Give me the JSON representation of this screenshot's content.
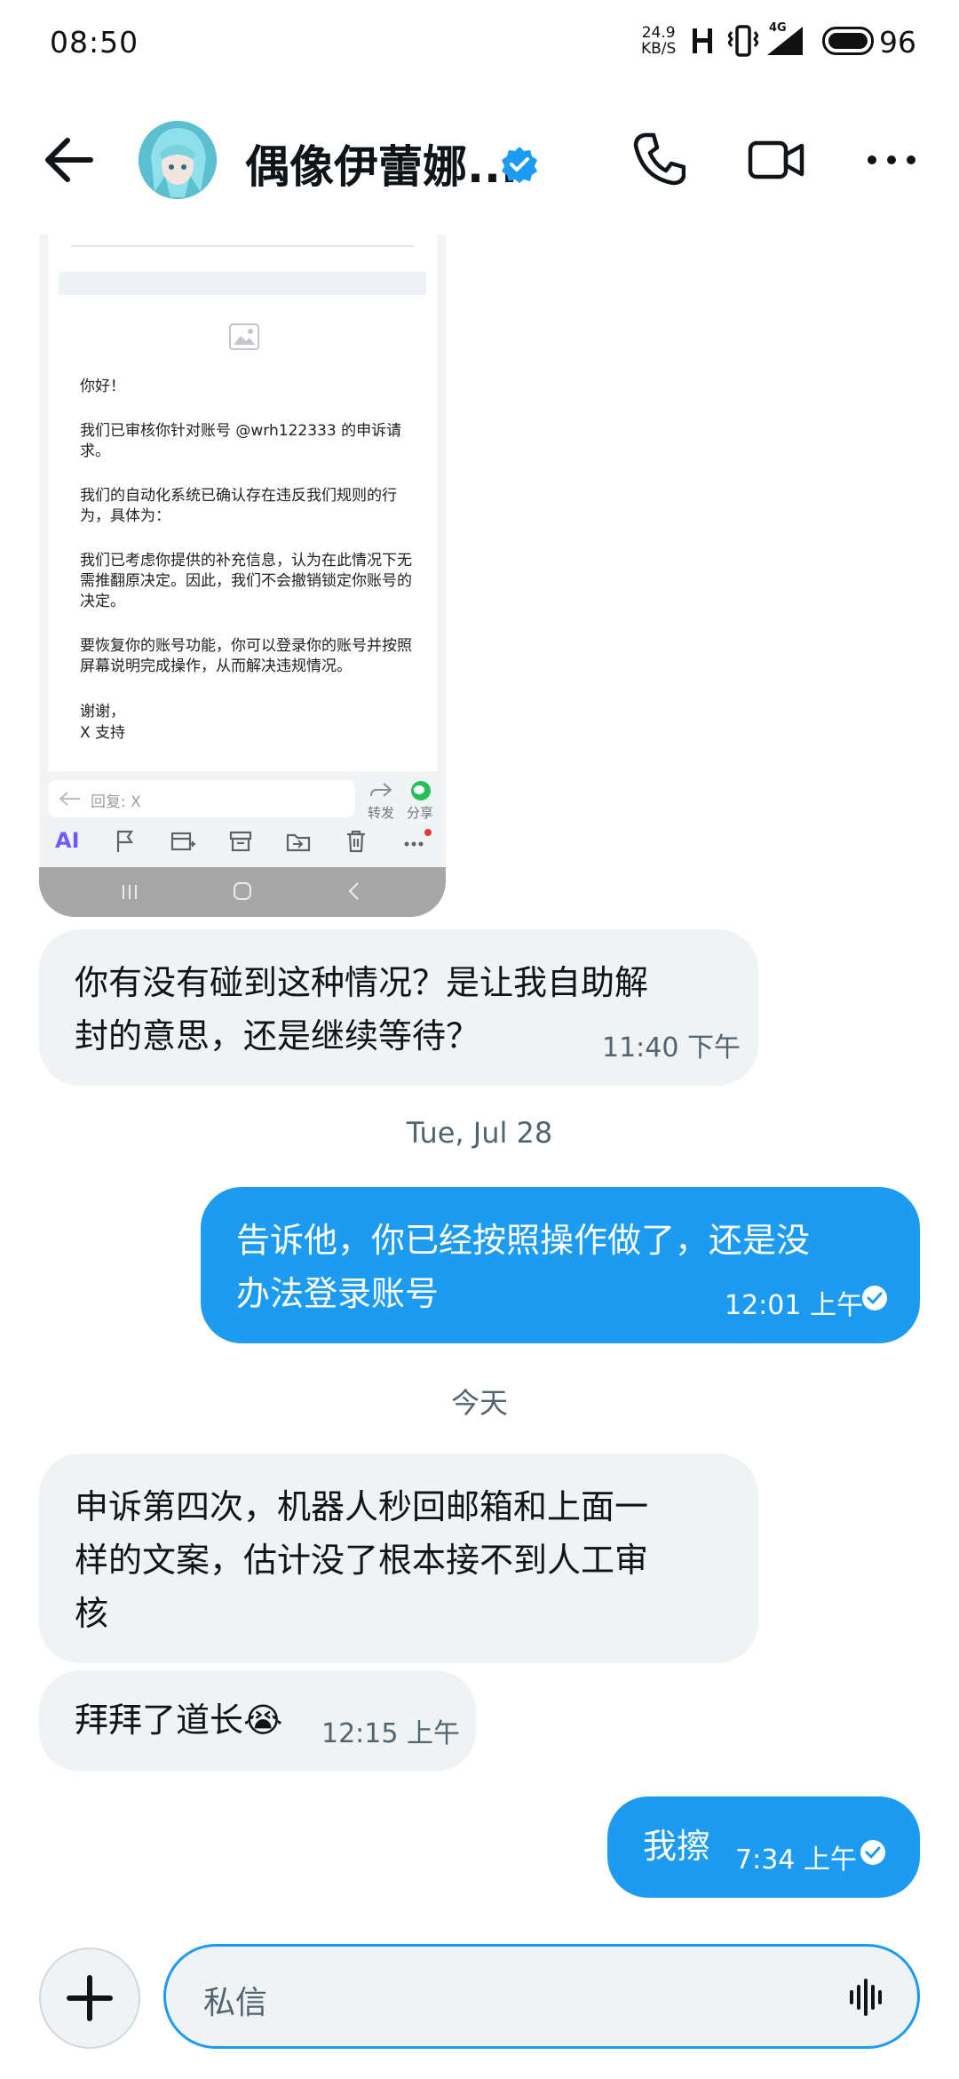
{
  "status_bar": {
    "time": "08:50",
    "net_speed_value": "24.9",
    "net_speed_unit": "KB/S",
    "network_type": "4G",
    "battery": "96"
  },
  "header": {
    "contact_name": "偶像伊蕾娜...",
    "verified": true,
    "icons": [
      "back-arrow-icon",
      "phone-icon",
      "video-icon",
      "more-icon"
    ]
  },
  "image_message": {
    "email_lines": [
      "你好！",
      "我们已审核你针对账号 @wrh122333 的申诉请求。",
      "我们的自动化系统已确认存在违反我们规则的行为，具体为：",
      "我们已考虑你提供的补充信息，认为在此情况下无需推翻原决定。因此，我们不会撤销锁定你账号的决定。",
      "要恢复你的账号功能，你可以登录你的账号并按照屏幕说明完成操作，从而解决违规情况。",
      "谢谢，",
      "X 支持"
    ],
    "reply_placeholder": "回复: X",
    "forward_label": "转发",
    "share_label": "分享",
    "ai_label": "AI"
  },
  "messages": [
    {
      "id": "m1",
      "direction": "in",
      "text_lines": [
        "你有没有碰到这种情况？是让我自助解",
        "封的意思，还是继续等待？"
      ],
      "time": "11:40 下午"
    },
    {
      "id": "m2",
      "direction": "out",
      "text_lines": [
        "告诉他，你已经按照操作做了，还是没",
        "办法登录账号"
      ],
      "time": "12:01 上午"
    },
    {
      "id": "m3",
      "direction": "in",
      "text_lines": [
        "申诉第四次，机器人秒回邮箱和上面一",
        "样的文案，估计没了根本接不到人工审",
        "核"
      ],
      "time": ""
    },
    {
      "id": "m4",
      "direction": "in",
      "text_lines": [
        "拜拜了道长😭"
      ],
      "time": "12:15 上午"
    },
    {
      "id": "m5",
      "direction": "out",
      "text_lines": [
        "我擦"
      ],
      "time": "7:34 上午"
    }
  ],
  "day_separators": [
    "Tue, Jul 28",
    "今天"
  ],
  "composer": {
    "placeholder": "私信"
  },
  "colors": {
    "accent": "#1d9bf0",
    "incoming_bubble": "#eff3f4",
    "secondary_text": "#536471"
  }
}
